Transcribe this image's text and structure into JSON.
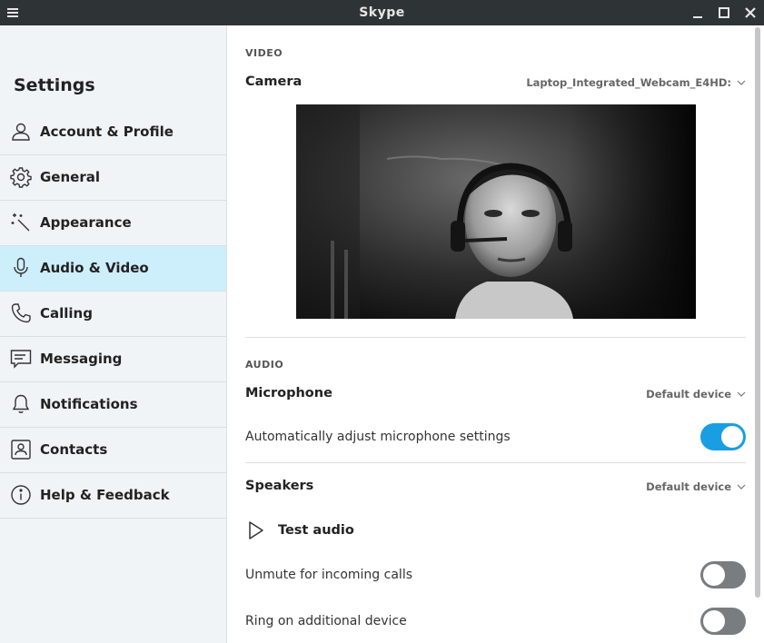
{
  "window": {
    "title": "Skype"
  },
  "sidebar": {
    "heading": "Settings",
    "items": [
      {
        "label": "Account & Profile",
        "icon": "person-icon",
        "active": false
      },
      {
        "label": "General",
        "icon": "gear-icon",
        "active": false
      },
      {
        "label": "Appearance",
        "icon": "magic-wand-icon",
        "active": false
      },
      {
        "label": "Audio & Video",
        "icon": "microphone-icon",
        "active": true
      },
      {
        "label": "Calling",
        "icon": "phone-icon",
        "active": false
      },
      {
        "label": "Messaging",
        "icon": "message-icon",
        "active": false
      },
      {
        "label": "Notifications",
        "icon": "bell-icon",
        "active": false
      },
      {
        "label": "Contacts",
        "icon": "contact-card-icon",
        "active": false
      },
      {
        "label": "Help & Feedback",
        "icon": "info-icon",
        "active": false
      }
    ]
  },
  "video": {
    "section_label": "VIDEO",
    "camera_label": "Camera",
    "camera_device": "Laptop_Integrated_Webcam_E4HD:"
  },
  "audio": {
    "section_label": "AUDIO",
    "microphone_label": "Microphone",
    "microphone_device": "Default device",
    "auto_adjust_label": "Automatically adjust microphone settings",
    "auto_adjust_on": true,
    "speakers_label": "Speakers",
    "speakers_device": "Default device",
    "test_audio_label": "Test audio",
    "unmute_label": "Unmute for incoming calls",
    "unmute_on": false,
    "ring_label": "Ring on additional device",
    "ring_on": false
  },
  "colors": {
    "accent": "#1a9ee3",
    "active_nav": "#cdeefb",
    "titlebar": "#2e3436"
  }
}
